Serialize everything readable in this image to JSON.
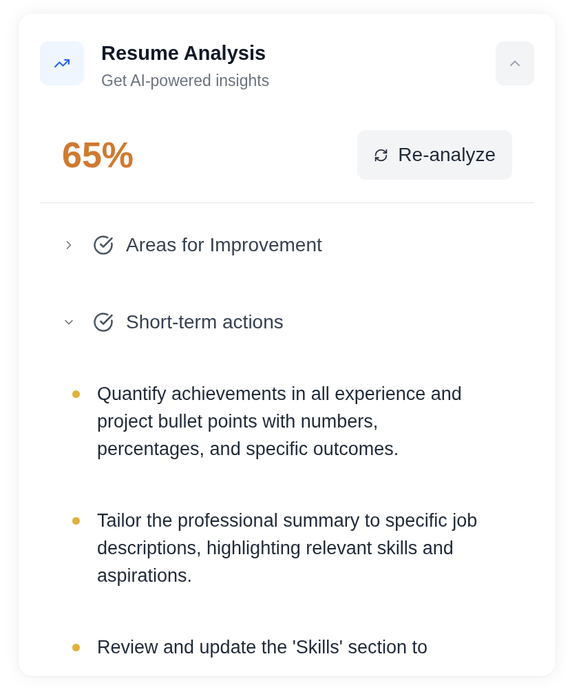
{
  "header": {
    "title": "Resume Analysis",
    "subtitle": "Get AI-powered insights",
    "expanded": true
  },
  "score": {
    "value": "65%",
    "action": "Re-analyze"
  },
  "sections": [
    {
      "title": "Areas for Improvement",
      "expanded": false
    },
    {
      "title": "Short-term actions",
      "expanded": true,
      "items": [
        "Quantify achievements in all experience and project bullet points with numbers, percentages, and specific outcomes.",
        "Tailor the professional summary to specific job descriptions, highlighting relevant skills and aspirations.",
        "Review and update the 'Skills' section to"
      ]
    }
  ]
}
